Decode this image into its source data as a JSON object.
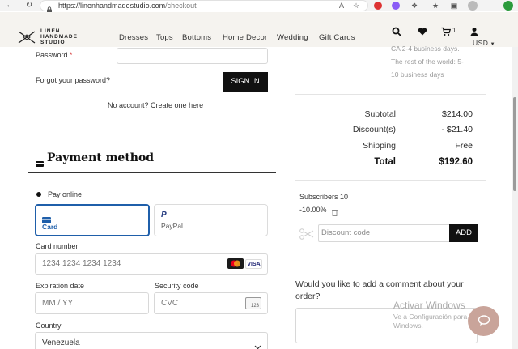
{
  "browser": {
    "url": "https://linenhandmadestudio.com/checkout",
    "url_base": "https://linenhandmadestudio.com",
    "url_path": "/checkout"
  },
  "brand": {
    "logo_lines": [
      "LINEN",
      "HANDMADE",
      "STUDIO"
    ]
  },
  "nav": {
    "items": [
      "Dresses",
      "Tops",
      "Bottoms",
      "Home Decor",
      "Wedding",
      "Gift Cards"
    ]
  },
  "header_icons": {
    "cart_count": "1",
    "currency": "USD",
    "icons": [
      "search-icon",
      "heart-icon",
      "cart-icon",
      "user-icon",
      "chevron-down-icon"
    ]
  },
  "login": {
    "password_label": "Password",
    "required_mark": "*",
    "forgot_link": "Forgot your password?",
    "signin_button": "SIGN IN",
    "create_account": "No account? Create one here"
  },
  "payment": {
    "title": "Payment method",
    "pay_online_label": "Pay online",
    "tabs": [
      {
        "label": "Card",
        "icon": "card-icon"
      },
      {
        "label": "PayPal",
        "icon": "paypal-icon"
      }
    ],
    "card_number_label": "Card number",
    "card_number_placeholder": "1234 1234 1234 1234",
    "card_brands": [
      "VISA"
    ],
    "expiration_label": "Expiration date",
    "expiration_placeholder": "MM / YY",
    "security_label": "Security code",
    "security_placeholder": "CVC",
    "cvc_icon_text": "123",
    "country_label": "Country",
    "country_value": "Venezuela"
  },
  "shipping_note": {
    "lines": [
      "CA 2-4 business days.",
      "The rest of the world: 5-",
      "10 business days"
    ]
  },
  "summary": {
    "rows": [
      {
        "label": "Subtotal",
        "value": "$214.00"
      },
      {
        "label": "Discount(s)",
        "value": "- $21.40"
      },
      {
        "label": "Shipping",
        "value": "Free"
      }
    ],
    "total_label": "Total",
    "total_value": "$192.60"
  },
  "discount": {
    "applied_name": "Subscribers 10",
    "applied_value": "-10.00%",
    "code_placeholder": "Discount code",
    "add_button": "ADD"
  },
  "comment": {
    "question": "Would you like to add a comment about your order?"
  },
  "watermark": {
    "title": "Activar Windows",
    "subtitle": "Ve a Configuración para activar Windows."
  },
  "colors": {
    "accent": "#111111",
    "header_bg": "#f5f3ef",
    "card_tab_border": "#1f5faa",
    "chat_bubble": "#c9a49a"
  }
}
